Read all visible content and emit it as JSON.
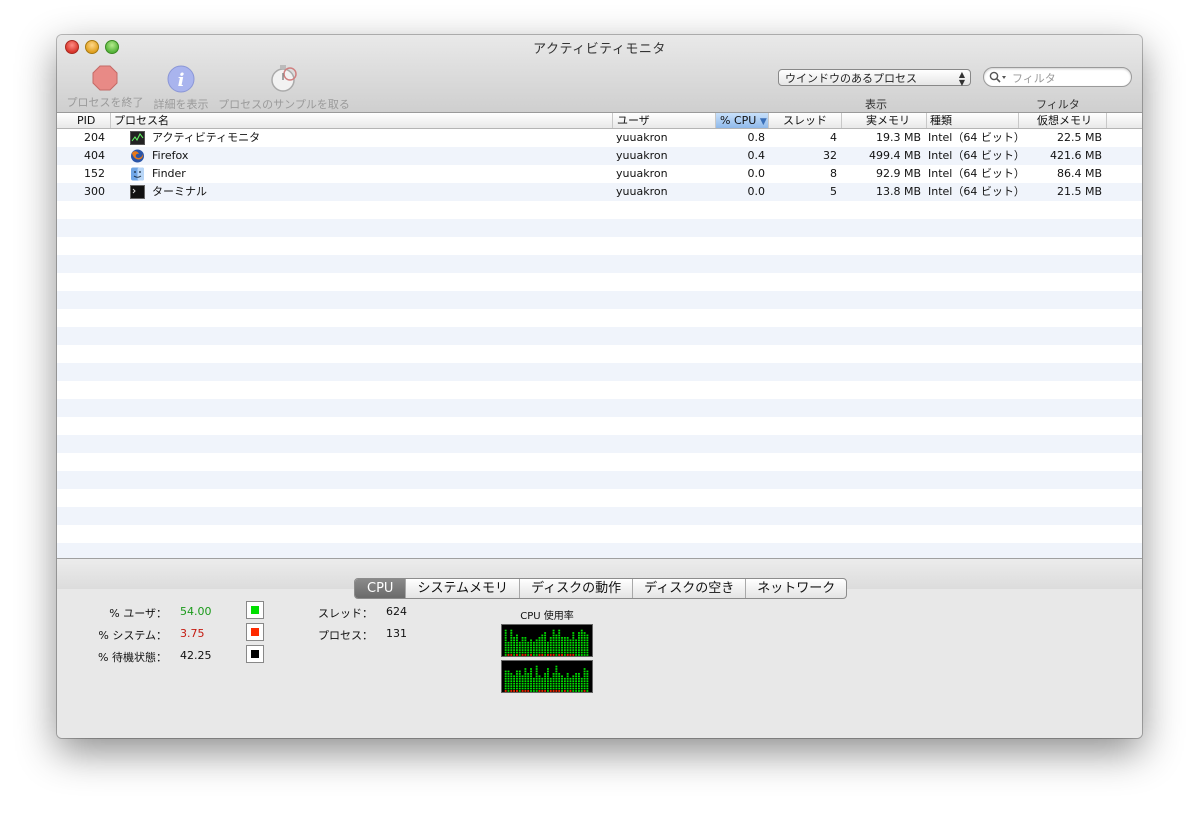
{
  "window": {
    "title": "アクティビティモニタ"
  },
  "toolbar": {
    "quit_label": "プロセスを終了",
    "info_label": "詳細を表示",
    "sample_label": "プロセスのサンプルを取る",
    "show_popup_value": "ウインドウのあるプロセス",
    "show_label": "表示",
    "filter_placeholder": "フィルタ",
    "filter_label": "フィルタ"
  },
  "table": {
    "columns": [
      "PID",
      "プロセス名",
      "ユーザ",
      "% CPU",
      "スレッド",
      "実メモリ",
      "種類",
      "仮想メモリ"
    ],
    "sort_indicator": "▼",
    "rows": [
      {
        "pid": "204",
        "name": "アクティビティモニタ",
        "icon": "activity-monitor-icon",
        "user": "yuuakron",
        "cpu": "0.8",
        "threads": "4",
        "real_mem": "19.3 MB",
        "kind": "Intel（64 ビット）",
        "virt_mem": "22.5 MB"
      },
      {
        "pid": "404",
        "name": "Firefox",
        "icon": "firefox-icon",
        "user": "yuuakron",
        "cpu": "0.4",
        "threads": "32",
        "real_mem": "499.4 MB",
        "kind": "Intel（64 ビット）",
        "virt_mem": "421.6 MB"
      },
      {
        "pid": "152",
        "name": "Finder",
        "icon": "finder-icon",
        "user": "yuuakron",
        "cpu": "0.0",
        "threads": "8",
        "real_mem": "92.9 MB",
        "kind": "Intel（64 ビット）",
        "virt_mem": "86.4 MB"
      },
      {
        "pid": "300",
        "name": "ターミナル",
        "icon": "terminal-icon",
        "user": "yuuakron",
        "cpu": "0.0",
        "threads": "5",
        "real_mem": "13.8 MB",
        "kind": "Intel（64 ビット）",
        "virt_mem": "21.5 MB"
      }
    ]
  },
  "tabs": [
    "CPU",
    "システムメモリ",
    "ディスクの動作",
    "ディスクの空き",
    "ネットワーク"
  ],
  "cpu": {
    "user_label": "% ユーザ：",
    "user_value": "54.00",
    "user_color": "#00e000",
    "system_label": "% システム：",
    "system_value": "3.75",
    "system_color": "#ff2a00",
    "idle_label": "% 待機状態：",
    "idle_value": "42.25",
    "idle_color": "#000000",
    "threads_label": "スレッド：",
    "threads_value": "624",
    "processes_label": "プロセス：",
    "processes_value": "131",
    "graph_title": "CPU 使用率"
  }
}
